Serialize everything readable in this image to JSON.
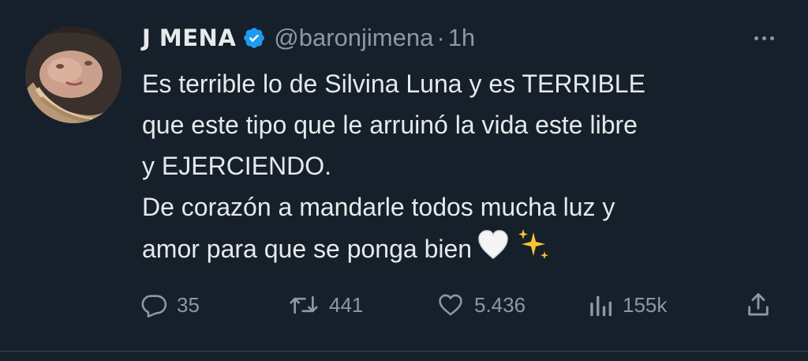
{
  "tweet": {
    "display_name": "J MENA",
    "display_name_prefix": "J",
    "display_name_main": "MENA",
    "verified": true,
    "handle": "@baronjimena",
    "separator": "·",
    "time": "1h",
    "more_icon": "more-horizontal-icon",
    "text_lines": [
      "Es terrible lo de Silvina Luna y es TERRIBLE",
      "que este tipo que le arruinó la vida este libre",
      "y EJERCIENDO.",
      "De corazón a mandarle todos mucha luz y",
      "amor para que se ponga bien"
    ],
    "emojis": [
      "white-heart-emoji",
      "sparkles-emoji"
    ],
    "actions": {
      "reply": {
        "icon": "reply-icon",
        "count": "35"
      },
      "retweet": {
        "icon": "retweet-icon",
        "count": "441"
      },
      "like": {
        "icon": "heart-icon",
        "count": "5.436"
      },
      "views": {
        "icon": "views-icon",
        "count": "155k"
      },
      "share": {
        "icon": "share-icon"
      }
    },
    "colors": {
      "background": "#15202b",
      "text": "#e7e9ea",
      "secondary": "#8b98a5",
      "verified": "#1d9bf0"
    }
  }
}
